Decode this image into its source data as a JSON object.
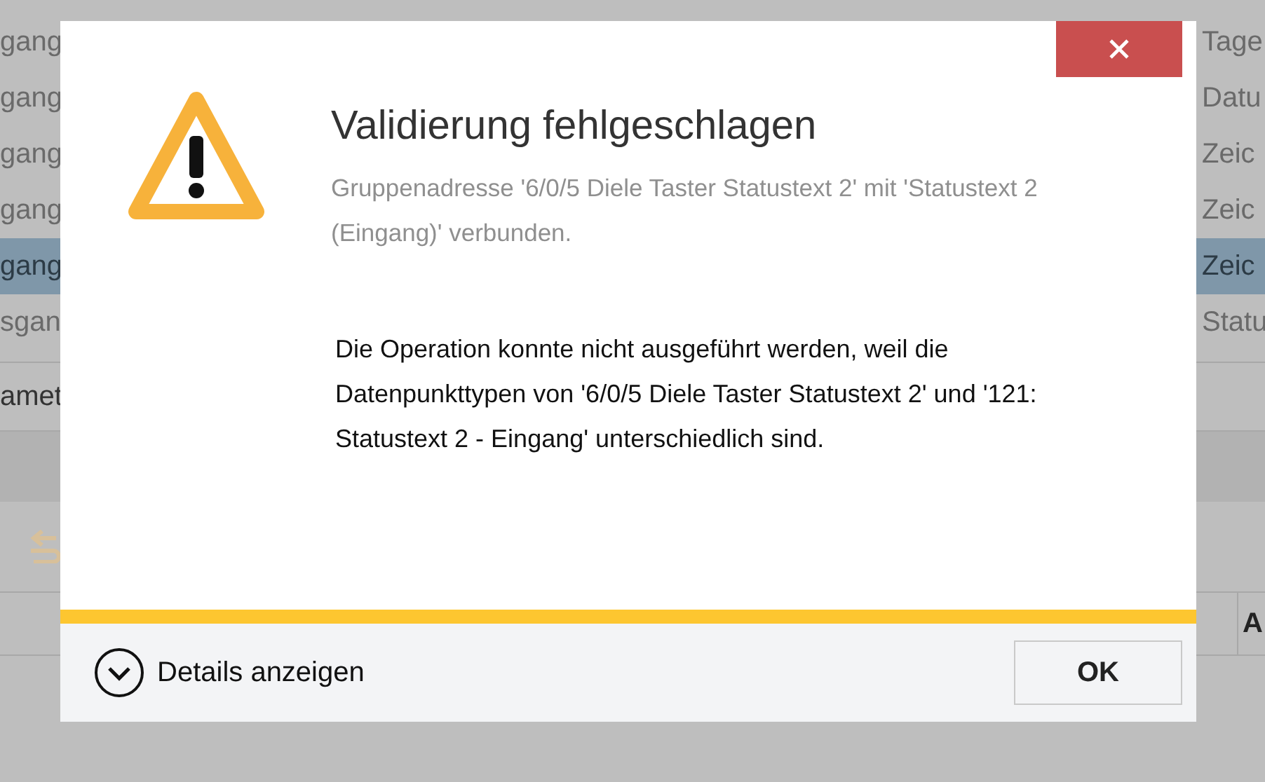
{
  "background_table": {
    "rows": [
      {
        "column_1": "gang",
        "column_2": "Tage",
        "selected": false
      },
      {
        "column_1": "gang",
        "column_2": "Datu",
        "selected": false
      },
      {
        "column_1": "gang",
        "column_2": "Zeic",
        "selected": false
      },
      {
        "column_1": "gang",
        "column_2": "Zeic",
        "selected": false
      },
      {
        "column_1": "gang",
        "column_2": "Zeic",
        "selected": true
      },
      {
        "column_1": "sgan",
        "column_2": "Statu",
        "selected": false
      }
    ],
    "section_label": "amet",
    "header_label": "A"
  },
  "dialog": {
    "title": "Validierung fehlgeschlagen",
    "subtitle": "Gruppenadresse '6/0/5 Diele Taster Statustext 2' mit 'Statustext 2 (Eingang)' verbunden.",
    "message": "Die Operation konnte nicht ausgeführt werden, weil die Datenpunkttypen von '6/0/5 Diele Taster Statustext 2' und '121: Statustext 2 - Eingang' unterschiedlich sind.",
    "details_button": "Details anzeigen",
    "ok_button": "OK"
  }
}
